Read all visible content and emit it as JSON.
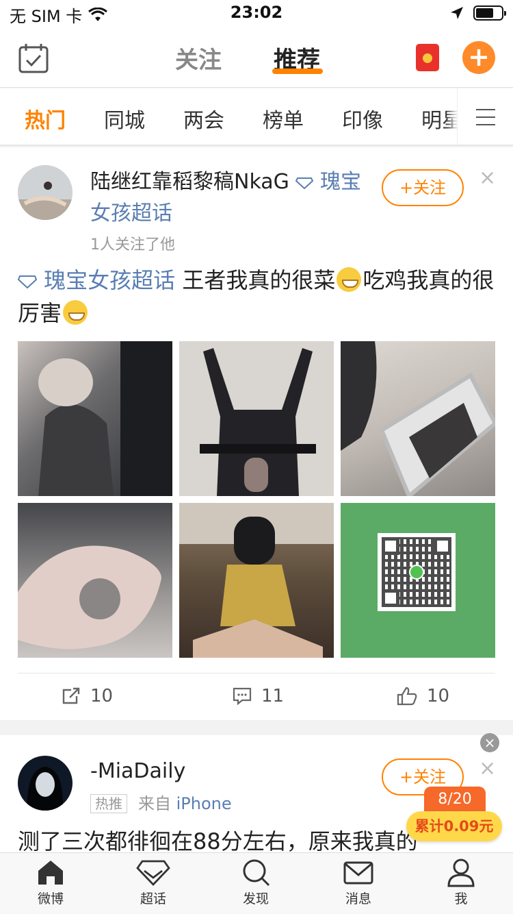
{
  "status_bar": {
    "carrier": "无 SIM 卡",
    "time": "23:02",
    "battery_percent": 70
  },
  "top_nav": {
    "tabs": [
      {
        "label": "关注",
        "active": false
      },
      {
        "label": "推荐",
        "active": true
      }
    ],
    "accent_color": "#ff8200"
  },
  "channels": [
    {
      "label": "热门",
      "active": true
    },
    {
      "label": "同城",
      "active": false
    },
    {
      "label": "两会",
      "active": false
    },
    {
      "label": "榜单",
      "active": false
    },
    {
      "label": "印像",
      "active": false
    },
    {
      "label": "明星",
      "active": false
    }
  ],
  "post1": {
    "username": "陆继红靠稻黎稿NkaG",
    "topic_badge": "瑰宝女孩超话",
    "follow_label": "+关注",
    "follower_note": "1人关注了他",
    "topic": "瑰宝女孩超话",
    "text_a": "王者我真的很菜",
    "text_b": "吃鸡我真的很厉害",
    "images": [
      "photo-1",
      "photo-2",
      "photo-3",
      "photo-4",
      "photo-5",
      "qr-code-image"
    ],
    "reposts": "10",
    "comments": "11",
    "likes": "10"
  },
  "post2": {
    "username": "-MiaDaily",
    "follow_label": "+关注",
    "hot_tag": "热推",
    "source_prefix": "来自",
    "device": "iPhone",
    "text": "测了三次都徘徊在88分左右，原来我真的"
  },
  "reward": {
    "progress": "8/20",
    "total": "累计0.09元"
  },
  "tab_bar": [
    {
      "label": "微博",
      "icon": "home-icon"
    },
    {
      "label": "超话",
      "icon": "diamond-icon"
    },
    {
      "label": "发现",
      "icon": "search-icon"
    },
    {
      "label": "消息",
      "icon": "mail-icon"
    },
    {
      "label": "我",
      "icon": "profile-icon"
    }
  ]
}
